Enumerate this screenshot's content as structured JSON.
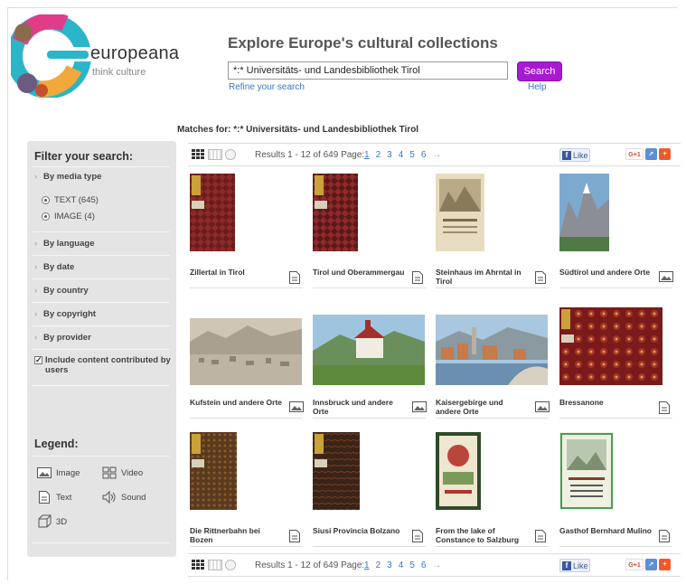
{
  "brand": {
    "name": "europeana",
    "tagline": "think culture"
  },
  "header": {
    "title": "Explore Europe's cultural collections",
    "search_value": "*:* Universitäts- und Landesbibliothek Tirol",
    "search_button": "Search",
    "refine_link": "Refine your search",
    "help_link": "Help"
  },
  "matches": {
    "label": "Matches for:",
    "query": "*:* Universitäts- und Landesbibliothek Tirol"
  },
  "sidebar": {
    "title": "Filter your search:",
    "facets": [
      {
        "label": "By media type"
      },
      {
        "label": "By language"
      },
      {
        "label": "By date"
      },
      {
        "label": "By country"
      },
      {
        "label": "By copyright"
      },
      {
        "label": "By provider"
      }
    ],
    "media_options": [
      {
        "label": "TEXT (645)"
      },
      {
        "label": "IMAGE (4)"
      }
    ],
    "ugc_checkbox": "Include content contributed by users",
    "legend_title": "Legend:",
    "legend": {
      "image": "Image",
      "video": "Video",
      "text": "Text",
      "sound": "Sound",
      "three_d": "3D"
    }
  },
  "toolbar": {
    "results": "Results 1 - 12 of 649",
    "page_label": "Page:",
    "pages": [
      "1",
      "2",
      "3",
      "4",
      "5",
      "6"
    ],
    "next_arrow": "→",
    "like_label": "Like",
    "gplus_label": "G+1"
  },
  "results": [
    {
      "title": "Zillertal in Tirol",
      "type": "text",
      "thumb": "book-red"
    },
    {
      "title": "Tirol und Oberammergau",
      "type": "text",
      "thumb": "book-red2"
    },
    {
      "title": "Steinhaus im Ahrntal in Tirol",
      "type": "text",
      "thumb": "postcard-paper"
    },
    {
      "title": "Südtirol und andere Orte",
      "type": "image",
      "thumb": "mountain"
    },
    {
      "title": "Kufstein und andere Orte",
      "type": "image",
      "thumb": "town-sepia"
    },
    {
      "title": "Innsbruck und andere Orte",
      "type": "image",
      "thumb": "church-color"
    },
    {
      "title": "Kaisergebirge und andere Orte",
      "type": "image",
      "thumb": "town-color"
    },
    {
      "title": "Bressanone",
      "type": "text",
      "thumb": "pattern-red"
    },
    {
      "title": "Die Rittnerbahn bei Bozen",
      "type": "text",
      "thumb": "book-brown"
    },
    {
      "title": "Siusi Provincia Bolzano",
      "type": "text",
      "thumb": "book-dark"
    },
    {
      "title": "From the lake of Constance to Salzburg",
      "type": "text",
      "thumb": "poster-green"
    },
    {
      "title": "Gasthof Bernhard Mulino",
      "type": "text",
      "thumb": "postcard-green"
    }
  ],
  "colors": {
    "search_button": "#a61ad1",
    "link": "#3a75c4",
    "sidebar_bg": "#e4e4e4"
  }
}
